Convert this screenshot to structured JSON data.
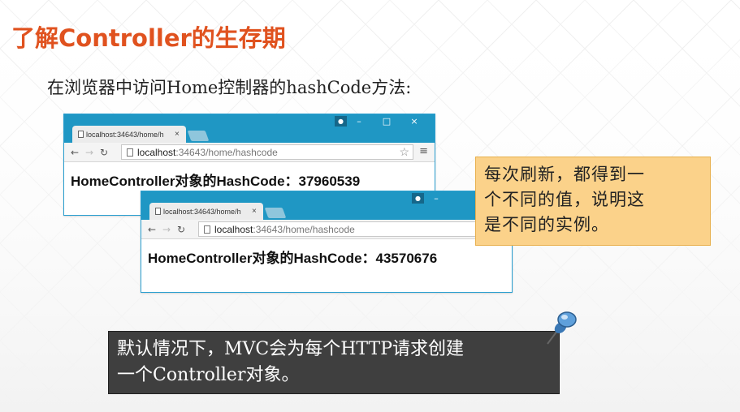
{
  "slide": {
    "title": "了解Controller的生存期",
    "intro": "在浏览器中访问Home控制器的hashCode方法:"
  },
  "browser1": {
    "tab_title": "localhost:34643/home/h",
    "tab_close": "×",
    "win_min": "–",
    "win_max": "□",
    "win_close": "×",
    "url_host": "localhost",
    "url_path": ":34643/home/hashcode",
    "content": "HomeController对象的HashCode：37960539"
  },
  "browser2": {
    "tab_title": "localhost:34643/home/h",
    "tab_close": "×",
    "win_min": "–",
    "url_host": "localhost",
    "url_path": ":34643/home/hashcode",
    "content": "HomeController对象的HashCode：43570676"
  },
  "note": {
    "line1": "每次刷新，都得到一",
    "line2": "个不同的值，说明这",
    "line3": "是不同的实例。"
  },
  "bottom_callout": {
    "line1": "默认情况下，MVC会为每个HTTP请求创建",
    "line2": "一个Controller对象。"
  },
  "colors": {
    "title": "#e0521f",
    "browser_frame": "#1f97c4",
    "note_bg": "#fbd28a",
    "callout_bg": "#3f3f3f"
  },
  "icons": [
    "back-arrow-icon",
    "forward-arrow-icon",
    "reload-icon",
    "page-icon",
    "star-icon",
    "menu-icon",
    "user-icon",
    "pushpin-icon"
  ]
}
